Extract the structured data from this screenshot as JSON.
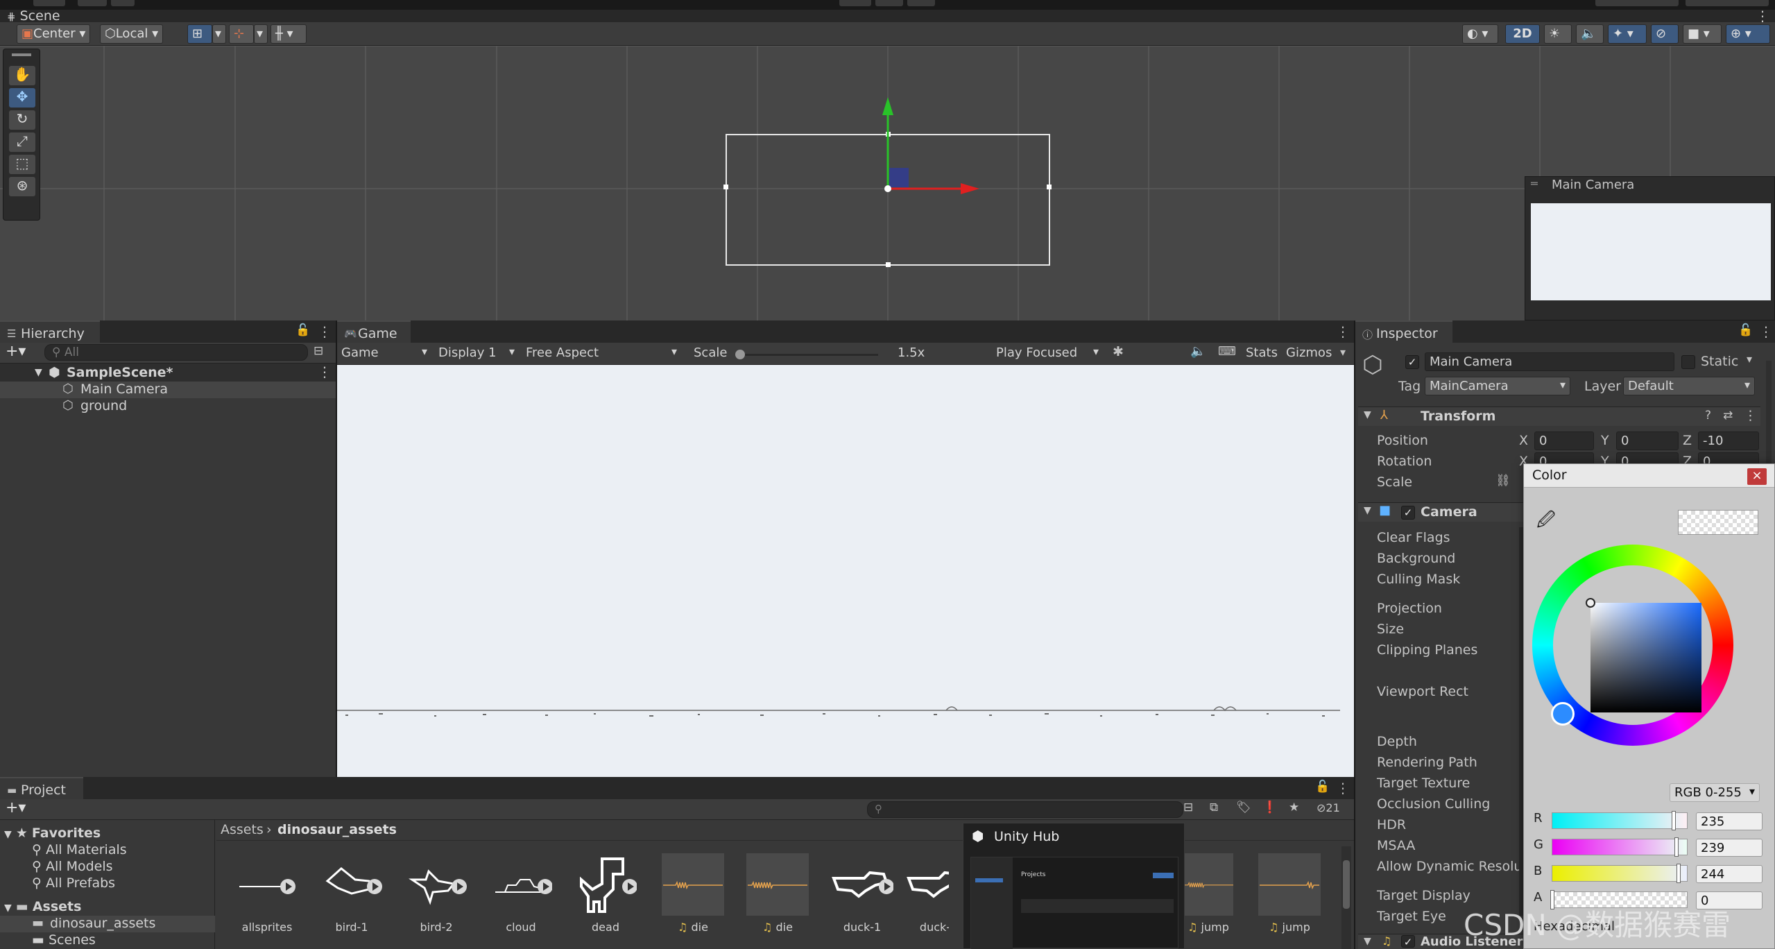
{
  "scene": {
    "tab": "Scene",
    "toolbar": {
      "pivot": "Center",
      "space": "Local",
      "mode2d": "2D"
    },
    "camera_overlay_title": "Main Camera"
  },
  "hierarchy": {
    "tab": "Hierarchy",
    "search_placeholder": "All",
    "items": [
      {
        "label": "SampleScene*",
        "kind": "scene"
      },
      {
        "label": "Main Camera",
        "kind": "object"
      },
      {
        "label": "ground",
        "kind": "object"
      }
    ]
  },
  "game": {
    "tab": "Game",
    "toolbar": {
      "view": "Game",
      "display": "Display 1",
      "aspect": "Free Aspect",
      "scale_label": "Scale",
      "scale_value": "1.5x",
      "scale_fraction": 0.0,
      "play_mode": "Play Focused",
      "stats": "Stats",
      "gizmos": "Gizmos"
    }
  },
  "inspector": {
    "tab": "Inspector",
    "object_name": "Main Camera",
    "object_active": true,
    "static_label": "Static",
    "tag_label": "Tag",
    "tag_value": "MainCamera",
    "layer_label": "Layer",
    "layer_value": "Default",
    "transform": {
      "title": "Transform",
      "position_label": "Position",
      "rotation_label": "Rotation",
      "scale_label": "Scale",
      "position": {
        "x": "0",
        "y": "0",
        "z": "-10"
      },
      "rotation": {
        "x": "0",
        "y": "0",
        "z": "0"
      },
      "axis_x": "X",
      "axis_y": "Y",
      "axis_z": "Z"
    },
    "camera": {
      "title": "Camera",
      "fields": [
        "Clear Flags",
        "Background",
        "Culling Mask",
        "Projection",
        "Size",
        "Clipping Planes",
        "Viewport Rect",
        "Depth",
        "Rendering Path",
        "Target Texture",
        "Occlusion Culling",
        "HDR",
        "MSAA",
        "Allow Dynamic Resolut",
        "Target Display",
        "Target Eye"
      ]
    },
    "audio_listener": "Audio Listener"
  },
  "color_picker": {
    "title": "Color",
    "close": "×",
    "mode": "RGB 0-255",
    "channels": [
      {
        "label": "R",
        "value": "235",
        "fraction": 0.92
      },
      {
        "label": "G",
        "value": "239",
        "fraction": 0.94
      },
      {
        "label": "B",
        "value": "244",
        "fraction": 0.96
      },
      {
        "label": "A",
        "value": "0",
        "fraction": 0.0
      }
    ],
    "hex_label": "Hexadecimal"
  },
  "project": {
    "tab": "Project",
    "hidden_count": "21",
    "favorites": {
      "label": "Favorites",
      "items": [
        "All Materials",
        "All Models",
        "All Prefabs"
      ]
    },
    "assets_label": "Assets",
    "folders": [
      "dinosaur_assets",
      "Scenes"
    ],
    "breadcrumb": [
      "Assets",
      "dinosaur_assets"
    ],
    "assets": [
      {
        "name": "allsprites",
        "kind": "sprite"
      },
      {
        "name": "bird-1",
        "kind": "sprite"
      },
      {
        "name": "bird-2",
        "kind": "sprite"
      },
      {
        "name": "cloud",
        "kind": "sprite"
      },
      {
        "name": "dead",
        "kind": "sprite"
      },
      {
        "name": "die",
        "kind": "audio"
      },
      {
        "name": "die",
        "kind": "audio"
      },
      {
        "name": "duck-1",
        "kind": "sprite"
      },
      {
        "name": "duck-",
        "kind": "sprite"
      },
      {
        "name": "jump",
        "kind": "audio"
      },
      {
        "name": "jump",
        "kind": "audio"
      }
    ]
  },
  "unity_hub_popup": {
    "title": "Unity Hub",
    "preview_heading": "Projects"
  },
  "watermark": "CSDN @数据猴赛雷",
  "colors": {
    "accent_blue": "#3d5a80",
    "axis_x": "#e02020",
    "axis_y": "#29c229",
    "game_background": "#ebeff4",
    "panel": "#383838",
    "toolbar": "#3c3c3c"
  }
}
